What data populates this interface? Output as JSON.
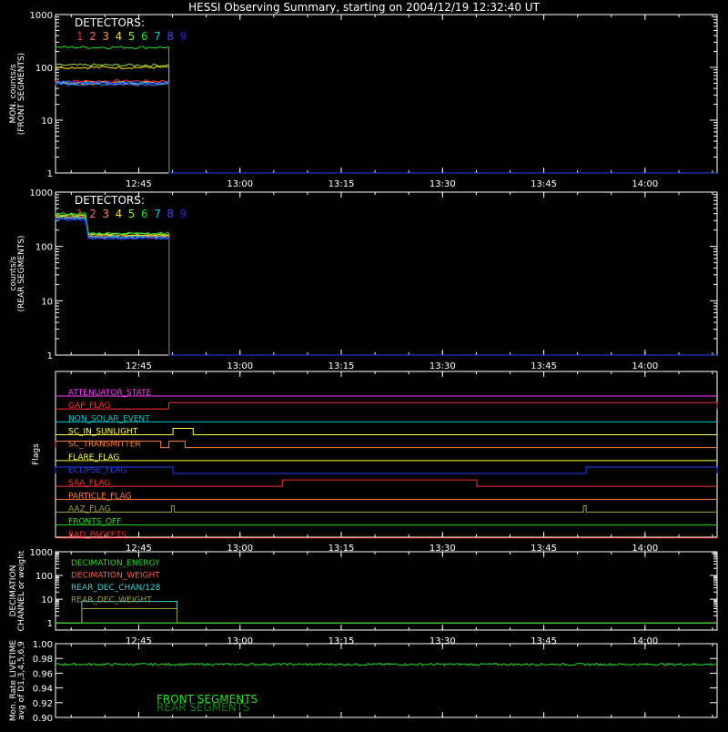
{
  "title": "HESSI Observing Summary, starting on 2004/12/19 12:32:40 UT",
  "colors": {
    "axis": "#ffffff",
    "det": [
      "#ff3030",
      "#ff6060",
      "#ff9040",
      "#ffe000",
      "#a0e040",
      "#20e020",
      "#00d0d0",
      "#4040ff",
      "#2020ff"
    ],
    "det1": "#ff3030",
    "det2": "#ff6060",
    "det3": "#ff9040",
    "det4": "#ffe000",
    "det5": "#a0e040",
    "det6": "#20e020",
    "det7": "#00d0d0",
    "det8": "#4080ff",
    "det9": "#2040ff"
  },
  "time_ticks": [
    "12:45",
    "13:00",
    "13:15",
    "13:30",
    "13:45",
    "14:00"
  ],
  "time_tick_minutes": [
    12.33,
    27.33,
    42.33,
    57.33,
    72.33,
    87.33
  ],
  "time_range_minutes": [
    0,
    98
  ],
  "log_ticks": [
    "1000",
    "100",
    "10",
    "1"
  ],
  "detectors": {
    "label": "DETECTORS:",
    "numbers": [
      "1",
      "2",
      "3",
      "4",
      "5",
      "6",
      "7",
      "8",
      "9"
    ]
  },
  "chart_data": [
    {
      "type": "line",
      "ylabel": "MON. counts/s\n(FRONT SEGMENTS)",
      "ylabel_line1": "MON. counts/s",
      "ylabel_line2": "(FRONT SEGMENTS)",
      "yscale": "log",
      "ylim": [
        1,
        1000
      ],
      "x_units": "minutes after 12:32:40 UT",
      "data_end_minute": 16.8,
      "series": [
        {
          "name": "1",
          "color": "#ff3030",
          "values_before_end": 55
        },
        {
          "name": "2",
          "color": "#ff6060",
          "values_before_end": 50
        },
        {
          "name": "3",
          "color": "#ff9040",
          "values_before_end": 52
        },
        {
          "name": "4",
          "color": "#ffe000",
          "values_before_end": 100
        },
        {
          "name": "5",
          "color": "#a0e040",
          "values_before_end": 110
        },
        {
          "name": "6",
          "color": "#20e020",
          "values_before_end": 240
        },
        {
          "name": "7",
          "color": "#00d0d0",
          "values_before_end": 50
        },
        {
          "name": "8",
          "color": "#4080ff",
          "values_before_end": 48
        },
        {
          "name": "9",
          "color": "#2040ff",
          "values_before_end": 52
        }
      ]
    },
    {
      "type": "line",
      "ylabel_line1": "counts/s",
      "ylabel_line2": "(REAR SEGMENTS)",
      "yscale": "log",
      "ylim": [
        1,
        1000
      ],
      "x_units": "minutes after 12:32:40 UT",
      "step_minute": 4.8,
      "data_end_minute": 16.8,
      "series": [
        {
          "name": "1",
          "color": "#ff3030",
          "values": [
            350,
            160
          ]
        },
        {
          "name": "2",
          "color": "#ff6060",
          "values": [
            330,
            150
          ]
        },
        {
          "name": "3",
          "color": "#ff9040",
          "values": [
            360,
            155
          ]
        },
        {
          "name": "4",
          "color": "#ffe000",
          "values": [
            370,
            165
          ]
        },
        {
          "name": "5",
          "color": "#a0e040",
          "values": [
            380,
            170
          ]
        },
        {
          "name": "6",
          "color": "#20e020",
          "values": [
            400,
            175
          ]
        },
        {
          "name": "7",
          "color": "#00d0d0",
          "values": [
            340,
            150
          ]
        },
        {
          "name": "8",
          "color": "#4080ff",
          "values": [
            320,
            145
          ]
        },
        {
          "name": "9",
          "color": "#2040ff",
          "values": [
            310,
            140
          ]
        }
      ]
    },
    {
      "type": "flags",
      "ylabel": "Flags",
      "flags": [
        {
          "name": "ATTENUATOR_STATE",
          "color": "#ff40ff",
          "on": []
        },
        {
          "name": "GAP_FLAG",
          "color": "#ff3030",
          "on": [
            [
              16.8,
              98
            ]
          ]
        },
        {
          "name": "NON_SOLAR_EVENT",
          "color": "#00d0d0",
          "on": []
        },
        {
          "name": "SC_IN_SUNLIGHT",
          "color": "#ffff40",
          "on": [
            [
              17.4,
              20.4
            ]
          ]
        },
        {
          "name": "SC_TRANSMITTER",
          "color": "#ff8040",
          "on": [
            [
              0,
              15.6
            ],
            [
              16.8,
              19.2
            ]
          ]
        },
        {
          "name": "FLARE_FLAG",
          "color": "#ffff40",
          "on": []
        },
        {
          "name": "ECLIPSE_FLAG",
          "color": "#2040ff",
          "on": [
            [
              0,
              17.4
            ],
            [
              78.6,
              98
            ]
          ]
        },
        {
          "name": "SAA_FLAG",
          "color": "#ff3030",
          "on": [
            [
              33.6,
              62.4
            ]
          ]
        },
        {
          "name": "PARTICLE_FLAG",
          "color": "#ff8040",
          "on": []
        },
        {
          "name": "AAZ_FLAG",
          "color": "#a0a040",
          "on": [
            [
              17.2,
              17.6
            ],
            [
              78.2,
              78.6
            ]
          ]
        },
        {
          "name": "FRONTS_OFF",
          "color": "#20e020",
          "on": []
        },
        {
          "name": "BAD_PACKETS",
          "color": "#ff3030",
          "on": []
        }
      ]
    },
    {
      "type": "line",
      "ylabel_line1": "DECIMATION",
      "ylabel_line2": "CHANNEL or weight",
      "yscale": "log",
      "ylim": [
        0.5,
        1000
      ],
      "legend": [
        "DECIMATION_ENERGY",
        "DECIMATION_WEIGHT",
        "REAR_DEC_CHAN/128",
        "REAR_DEC_WEIGHT"
      ],
      "legend_colors": [
        "#20e020",
        "#ff6040",
        "#40d0d0",
        "#a0a040"
      ],
      "series": [
        {
          "name": "REAR_DEC_CHAN/128",
          "color": "#40d0d0",
          "x": [
            0,
            3.9,
            3.9,
            18,
            18,
            98
          ],
          "values": [
            1,
            1,
            8,
            8,
            1,
            1
          ]
        },
        {
          "name": "REAR_DEC_WEIGHT",
          "color": "#a0a040",
          "x": [
            0,
            3.9,
            3.9,
            18,
            18,
            98
          ],
          "values": [
            1,
            1,
            4,
            4,
            1,
            1
          ]
        },
        {
          "name": "DECIMATION_WEIGHT",
          "color": "#ff6040",
          "x": [
            0,
            98
          ],
          "values": [
            1,
            1
          ]
        },
        {
          "name": "DECIMATION_ENERGY",
          "color": "#20e020",
          "x": [
            0,
            98
          ],
          "values": [
            1,
            1
          ]
        }
      ]
    },
    {
      "type": "line",
      "ylabel_line1": "Mon. Rate LIVETIME",
      "ylabel_line2": "avg of D1,3,4,5,6,9",
      "ylim": [
        0.9,
        1.0
      ],
      "yticks": [
        "1.00",
        "0.98",
        "0.96",
        "0.94",
        "0.92",
        "0.90"
      ],
      "legend": [
        "FRONT SEGMENTS",
        "REAR SEGMENTS"
      ],
      "legend_colors": [
        "#20e020",
        "#108010"
      ],
      "series": [
        {
          "name": "FRONT SEGMENTS",
          "color": "#20e020",
          "mean": 0.972,
          "noise": 0.0015
        }
      ]
    }
  ]
}
